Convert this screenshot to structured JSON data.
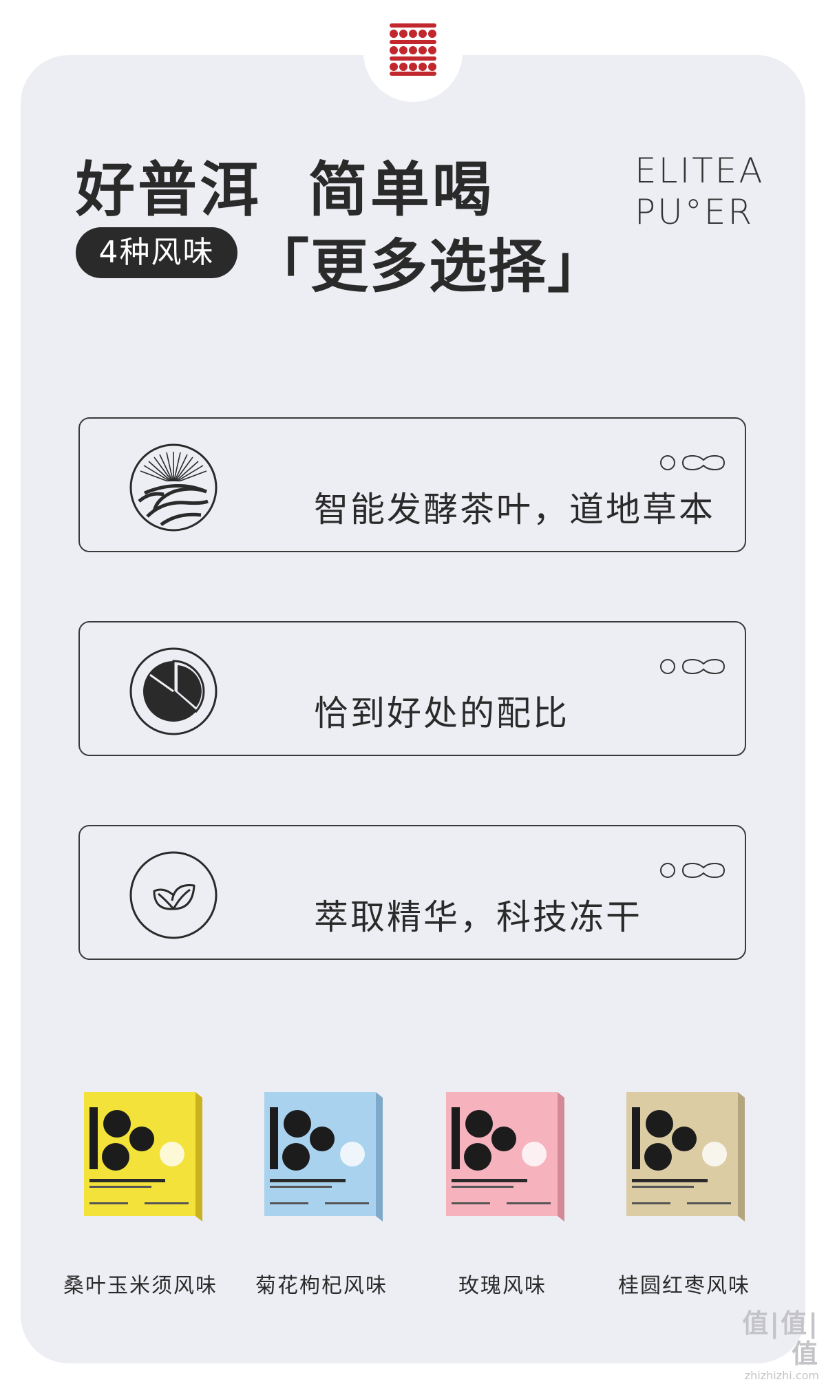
{
  "header": {
    "title_line1": "好普洱  简单喝",
    "badge": "4种风味",
    "title_line2": "「更多选择」",
    "brand_en_line1": "ELITEA",
    "brand_en_line2": "PU°ER"
  },
  "features": [
    {
      "label": "智能发酵茶叶，道地草本",
      "icon": "terraced-hills-sun-icon"
    },
    {
      "label": "恰到好处的配比",
      "icon": "pie-chart-icon"
    },
    {
      "label": "萃取精华，科技冻干",
      "icon": "leaf-icon"
    }
  ],
  "products": [
    {
      "name": "桑叶玉米须风味",
      "color": "#f2e23a"
    },
    {
      "name": "菊花枸杞风味",
      "color": "#a9d2ef"
    },
    {
      "name": "玫瑰风味",
      "color": "#f6b2bd"
    },
    {
      "name": "桂圆红枣风味",
      "color": "#dccca4"
    }
  ],
  "colors": {
    "brand_red": "#c1272d",
    "panel_bg": "#edeef4",
    "dark": "#2a2a2a"
  },
  "watermark": {
    "glyphs": "值|值|值",
    "url": "zhizhizhi.com"
  }
}
